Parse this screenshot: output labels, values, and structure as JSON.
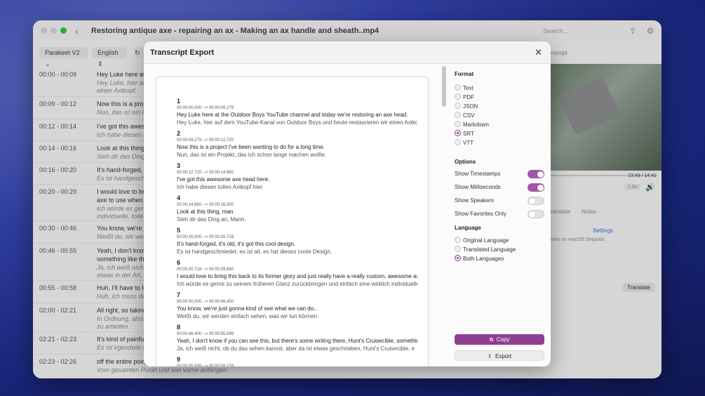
{
  "window": {
    "title": "Restoring antique axe - repairing an ax - Making an ax handle and sheath..mp4",
    "search_placeholder": "Search..."
  },
  "toolbar": {
    "model": "Parakeet V2",
    "language": "English"
  },
  "segments": [
    {
      "time": "00:00 - 00:09",
      "en": "Hey Luke here at t",
      "de": [
        "Hey Luke, hier auf",
        "einen Axtkopf."
      ]
    },
    {
      "time": "00:09 - 00:12",
      "en": "Now this is a proje",
      "de": [
        "Nun, das ist ein Pr"
      ]
    },
    {
      "time": "00:12 - 00:14",
      "en": "I've got this aweso",
      "de": [
        "Ich habe diesen to"
      ]
    },
    {
      "time": "00:14 - 00:16",
      "en": "Look at this thing,",
      "de": [
        "Sieh dir das Ding a"
      ]
    },
    {
      "time": "00:16 - 00:20",
      "en": "It's hand-forged, i",
      "de": [
        "Es ist handgeschm"
      ]
    },
    {
      "time": "00:20 - 00:29",
      "en": "I would love to brin",
      "en2": "axe to use when c",
      "de": [
        "Ich würde es gern",
        "individuelle, tolle A"
      ]
    },
    {
      "time": "00:30 - 00:46",
      "en": "You know, we're ju",
      "de": [
        "Weißt du, wir wer"
      ]
    },
    {
      "time": "00:46 - 00:55",
      "en": "Yeah, I don't know",
      "en2": "something like tha",
      "de": [
        "Ja, ich weiß nicht,",
        "etwas in der Art."
      ]
    },
    {
      "time": "00:55 - 00:58",
      "en": "Huh, I'll have to lo",
      "de": [
        "Huh, ich muss da"
      ]
    },
    {
      "time": "02:00 - 02:21",
      "en": "All right, so taking",
      "de": [
        "In Ordnung, also n",
        "zu arbeiten."
      ]
    },
    {
      "time": "02:21 - 02:23",
      "en": "It's kind of painful",
      "de": [
        "Es ist irgendwie s"
      ]
    },
    {
      "time": "02:23 - 02:26",
      "en": "off the entire point",
      "de": [
        "Vom gesamten Punkt und von vorne anfangen."
      ]
    }
  ],
  "right": {
    "tab_translate": "ranslate",
    "tab_notes": "Notes",
    "tab_transcript": "nscript",
    "settings_link": "Settings",
    "time": "13:49 / 14:41",
    "speed": "1.0x",
    "note": "orks on macOS Sequoia.",
    "translate_button": "Translate"
  },
  "modal": {
    "title": "Transcript Export",
    "entries": [
      {
        "num": "1",
        "ts": "00:00:00,000 --> 00:00:09,279",
        "en": "Hey Luke here at the Outdoor Boys YouTube channel and today we're restoring an axe head.",
        "de": "Hey Luke, hier auf dem YouTube-Kanal von Outdoor Boys und heute restaurieren wir einen Axtkop"
      },
      {
        "num": "2",
        "ts": "00:00:09,279 --> 00:00:12,720",
        "en": "Now this is a project I've been wanting to do for a long time.",
        "de": "Nun, das ist ein Projekt, das ich schon lange machen wollte."
      },
      {
        "num": "3",
        "ts": "00:00:12,720 --> 00:00:14,960",
        "en": "I've got this awesome axe head here.",
        "de": "Ich habe diesen tollen Axtkopf hier."
      },
      {
        "num": "4",
        "ts": "00:00:14,960 --> 00:00:16,000",
        "en": "Look at this thing, man.",
        "de": "Sieh dir das Ding an, Mann."
      },
      {
        "num": "5",
        "ts": "00:00:16,000 --> 00:00:20,719",
        "en": "It's hand-forged, it's old, it's got this cool design.",
        "de": "Es ist handgeschmiedet, es ist alt, es hat dieses coole Design."
      },
      {
        "num": "6",
        "ts": "00:00:20,719 --> 00:00:29,840",
        "en": "I would love to bring this back to its former glory and just really have a really custom, awesome axe",
        "de": "Ich würde es gerne zu seinem früheren Glanz zurückbringen und einfach eine wirklich individuelle"
      },
      {
        "num": "7",
        "ts": "00:00:30,000 --> 00:00:46,400",
        "en": "You know, we're just gonna kind of see what we can do..",
        "de": "Weißt du, wir werden einfach sehen, was wir tun können."
      },
      {
        "num": "8",
        "ts": "00:00:46,400 --> 00:00:55,599",
        "en": "Yeah, I don't know if you can see this, but there's some writing there, Hunt's Cruisecible, somethin",
        "de": "Ja, ich weiß nicht, ob du das sehen kannst, aber da ist etwas geschrieben, Hunt's Cruisecible, e"
      },
      {
        "num": "9",
        "ts": "00:00:55,599 --> 00:00:58,159",
        "en": "",
        "de": ""
      }
    ],
    "panel": {
      "format_label": "Format",
      "formats": [
        "Text",
        "PDF",
        "JSON",
        "CSV",
        "Markdown",
        "SRT",
        "VTT"
      ],
      "format_selected": "SRT",
      "options_label": "Options",
      "options": [
        {
          "label": "Show Timestamps",
          "on": true
        },
        {
          "label": "Show Milliseconds",
          "on": true
        },
        {
          "label": "Show Speakers",
          "on": false
        },
        {
          "label": "Show Favorites Only",
          "on": false
        }
      ],
      "language_label": "Language",
      "languages": [
        "Original Language",
        "Translated Language",
        "Both Languages"
      ],
      "language_selected": "Both Languages",
      "copy_label": "Copy",
      "export_label": "Export"
    }
  },
  "colors": {
    "accent": "#8e3f92",
    "toggle_on": "#a256a5"
  }
}
